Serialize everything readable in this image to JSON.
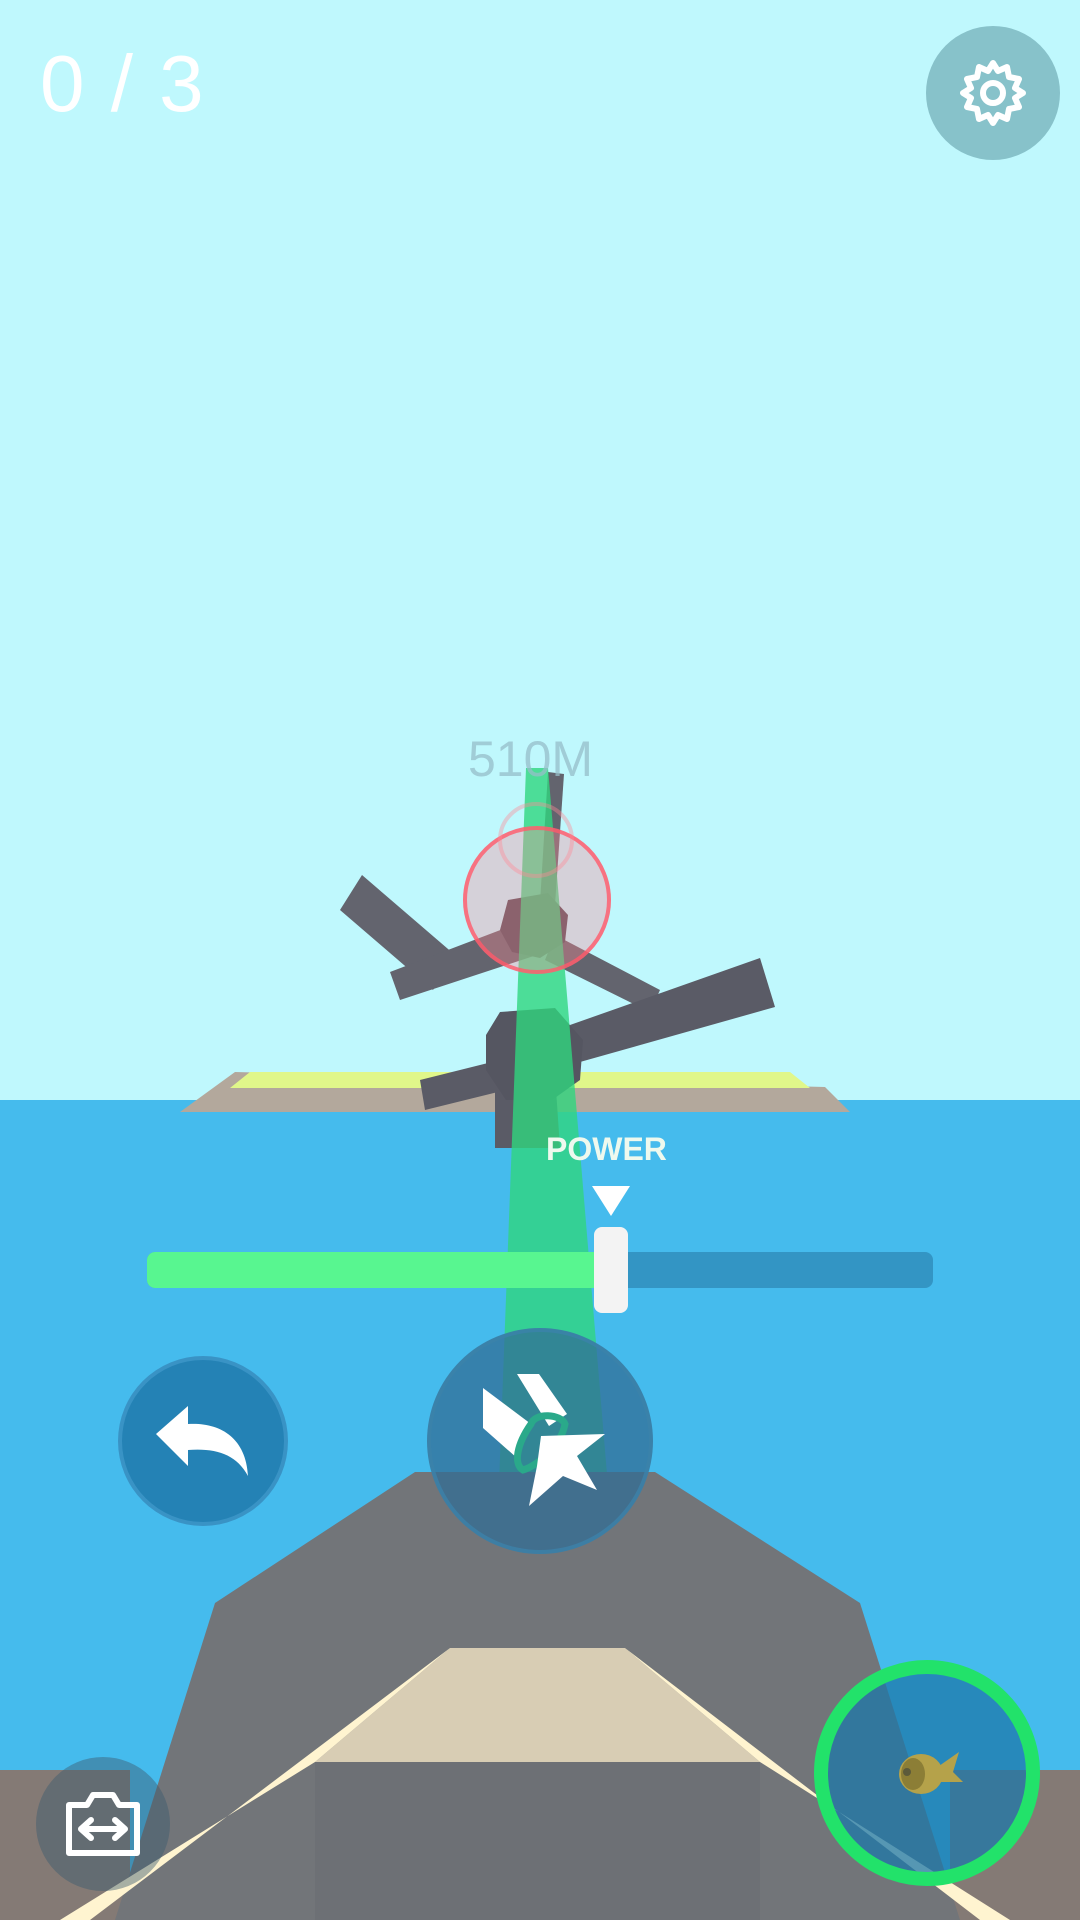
{
  "hud": {
    "score_text": "0 / 3",
    "distance_text": "510M",
    "power_label": "POWER"
  },
  "power": {
    "level": 0.59
  },
  "icons": {
    "settings": "gear-icon",
    "undo": "undo-arrow-icon",
    "fire": "cannon-fire-icon",
    "camera": "camera-switch-icon",
    "weapon": "missile-icon"
  },
  "colors": {
    "sky": "#bff8fd",
    "sea": "#45bbed",
    "power_fill": "#58f690",
    "power_track": "#3395c4",
    "weapon_ring": "#22e26a",
    "aim_beam": "#3de08a",
    "target_ring": "#ff5a6a"
  }
}
